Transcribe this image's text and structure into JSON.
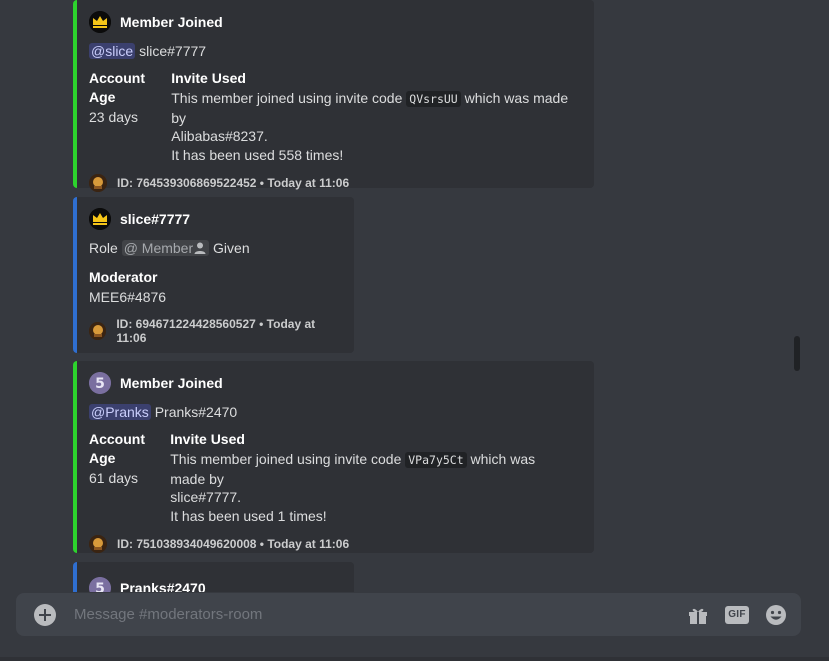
{
  "messages": [
    {
      "type": "member_joined",
      "author": "Member Joined",
      "mention": "@slice",
      "user": "slice#7777",
      "account_age_label": "Account Age",
      "account_age": "23 days",
      "invite_label": "Invite Used",
      "invite_pre": "This member joined using invite code ",
      "invite_code": "QVsrsUU",
      "invite_post": " which was made by",
      "invite_maker": "Alibabas#8237.",
      "invite_uses": "It has been used 558 times!",
      "footer": "ID: 764539306869522452 • Today at 11:06"
    },
    {
      "type": "role_given",
      "author": "slice#7777",
      "role_prefix": "Role ",
      "role_mention": "@ Member",
      "role_suffix": " Given",
      "moderator_label": "Moderator",
      "moderator": "MEE6#4876",
      "footer": "ID: 694671224428560527 • Today at 11:06"
    },
    {
      "type": "member_joined",
      "author": "Member Joined",
      "mention": "@Pranks",
      "user": "Pranks#2470",
      "account_age_label": "Account Age",
      "account_age": "61 days",
      "invite_label": "Invite Used",
      "invite_pre": "This member joined using invite code ",
      "invite_code": "VPa7y5Ct",
      "invite_post": " which was made by",
      "invite_maker": "slice#7777.",
      "invite_uses": "It has been used 1 times!",
      "footer": "ID: 751038934049620008 • Today at 11:06"
    },
    {
      "type": "partial",
      "author": "Pranks#2470"
    }
  ],
  "composer": {
    "placeholder": "Message #moderators-room",
    "gift_icon": "gift-icon",
    "gif_label": "GIF",
    "emoji_icon": "emoji-icon"
  },
  "scroll": {
    "position": 0.61,
    "visible_fraction": 0.06
  },
  "colors": {
    "background": "#36393f",
    "embed_background": "#2f3136",
    "joined_accent": "#2dd32d",
    "role_accent": "#2f6fd1",
    "composer": "#40444b"
  }
}
